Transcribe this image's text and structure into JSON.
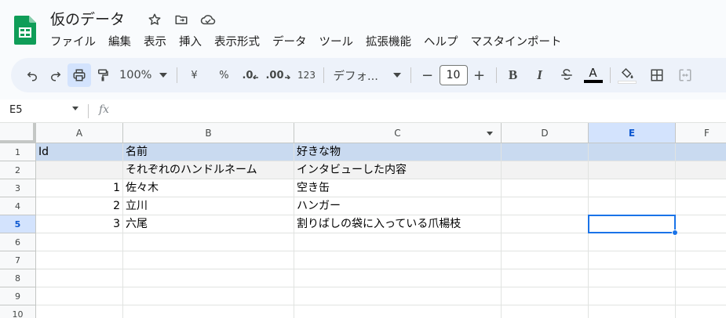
{
  "app": {
    "title": "仮のデータ",
    "menu": [
      "ファイル",
      "編集",
      "表示",
      "挿入",
      "表示形式",
      "データ",
      "ツール",
      "拡張機能",
      "ヘルプ",
      "マスタインポート"
    ]
  },
  "toolbar": {
    "zoom": "100%",
    "currency": "¥",
    "percent": "%",
    "decrease_decimal": ".0",
    "increase_decimal": ".00",
    "number_format": "123",
    "font": "デフォ...",
    "font_size": "10",
    "minus": "−",
    "plus": "+",
    "bold": "B",
    "italic": "I",
    "text_color_letter": "A"
  },
  "formula_bar": {
    "name_box": "E5",
    "fx": "fx",
    "value": ""
  },
  "sheet": {
    "columns": [
      "A",
      "B",
      "C",
      "D",
      "E",
      "F"
    ],
    "selected_column": "E",
    "row_numbers": [
      "1",
      "2",
      "3",
      "4",
      "5",
      "6",
      "7",
      "8",
      "9",
      "10"
    ],
    "selected_row": "5",
    "rows": [
      [
        "Id",
        "名前",
        "好きな物",
        "",
        "",
        ""
      ],
      [
        "",
        "それぞれのハンドルネーム",
        "インタビューした内容",
        "",
        "",
        ""
      ],
      [
        "1",
        "佐々木",
        "空き缶",
        "",
        "",
        ""
      ],
      [
        "2",
        "立川",
        "ハンガー",
        "",
        "",
        ""
      ],
      [
        "3",
        "六尾",
        "割りばしの袋に入っている爪楊枝",
        "",
        "",
        ""
      ],
      [
        "",
        "",
        "",
        "",
        "",
        ""
      ],
      [
        "",
        "",
        "",
        "",
        "",
        ""
      ],
      [
        "",
        "",
        "",
        "",
        "",
        ""
      ],
      [
        "",
        "",
        "",
        "",
        "",
        ""
      ],
      [
        "",
        "",
        "",
        "",
        "",
        ""
      ]
    ],
    "header_row_color": "#c9daf0",
    "subheader_row_color": "#f2f2f2",
    "selection_color": "#1a73e8"
  },
  "colors": {
    "sheets_green": "#0f9d58",
    "toolbar_bg": "#edf2fa",
    "selected_header_bg": "#d3e3fd"
  }
}
